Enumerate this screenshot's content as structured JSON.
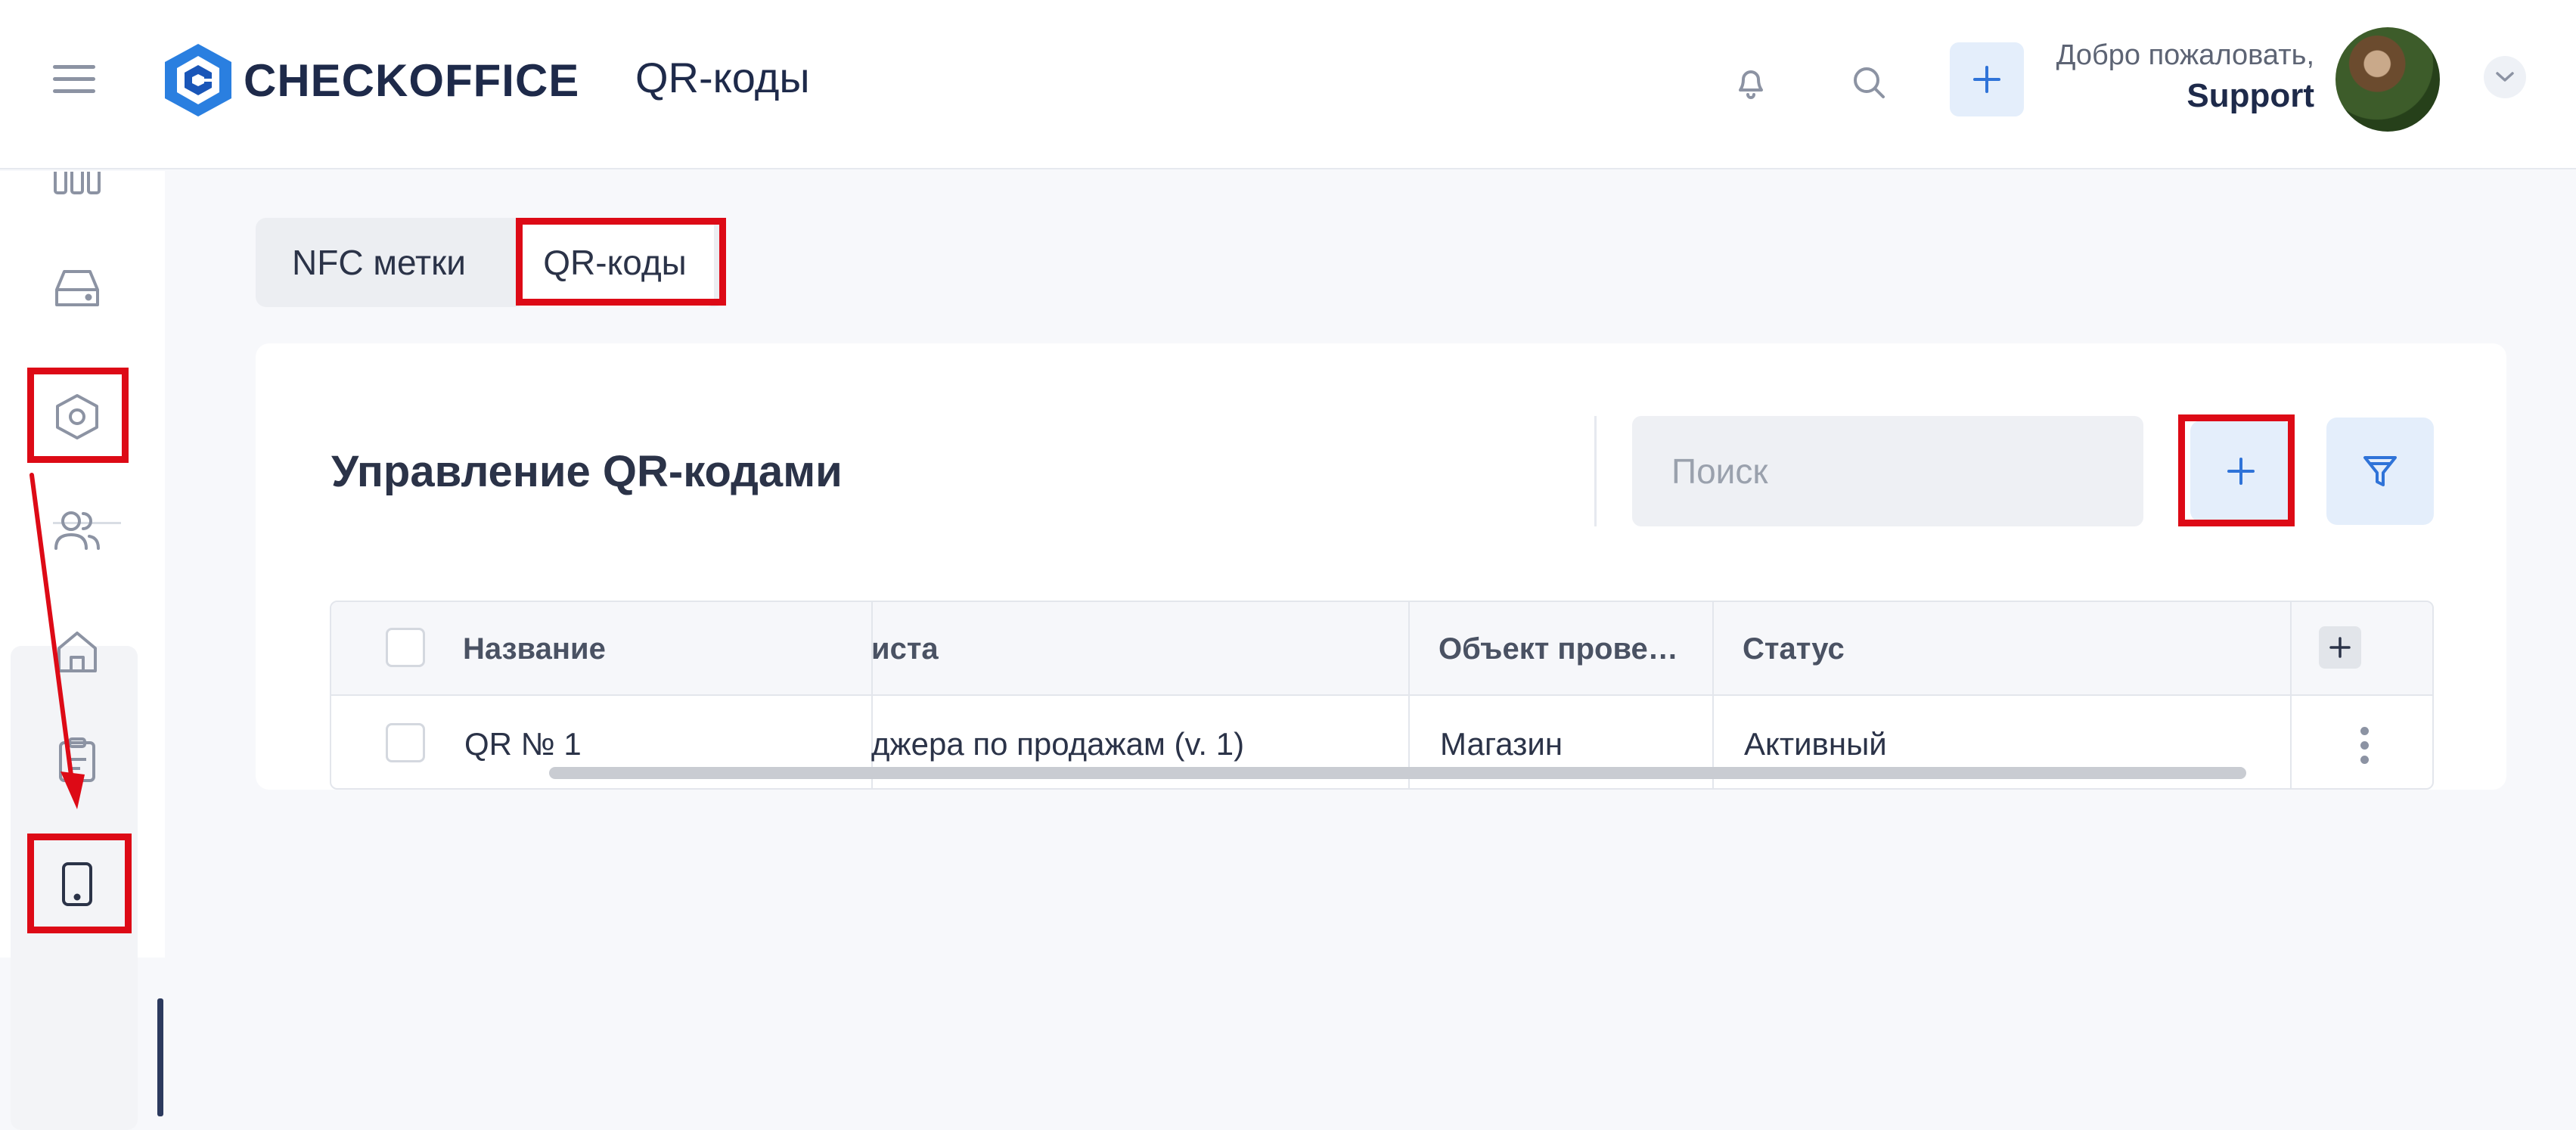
{
  "header": {
    "brand": "CHECKOFFICE",
    "page_title": "QR-коды",
    "welcome": "Добро пожаловать,",
    "user_name": "Support"
  },
  "tabs": [
    {
      "label": "NFC метки",
      "active": false
    },
    {
      "label": "QR-коды",
      "active": true
    }
  ],
  "card": {
    "title": "Управление QR-кодами",
    "search_placeholder": "Поиск"
  },
  "table": {
    "columns": [
      "Название",
      "иста",
      "Объект прове…",
      "Статус"
    ],
    "rows": [
      {
        "name": "QR № 1",
        "checklist": "джера по продажам (v. 1)",
        "object": "Магазин",
        "status": "Активный"
      }
    ]
  },
  "colors": {
    "accent": "#2f73d8",
    "logo": "#2a7fe0",
    "annotation": "#dd0a16"
  },
  "icons": {
    "sidebar": [
      "columns-icon",
      "hard-drive-icon",
      "settings-hexagon-icon",
      "users-icon",
      "building-icon",
      "clipboard-icon",
      "tablet-icon"
    ],
    "header": [
      "menu-icon",
      "bell-icon",
      "search-icon",
      "plus-icon",
      "chevron-down-icon"
    ]
  }
}
